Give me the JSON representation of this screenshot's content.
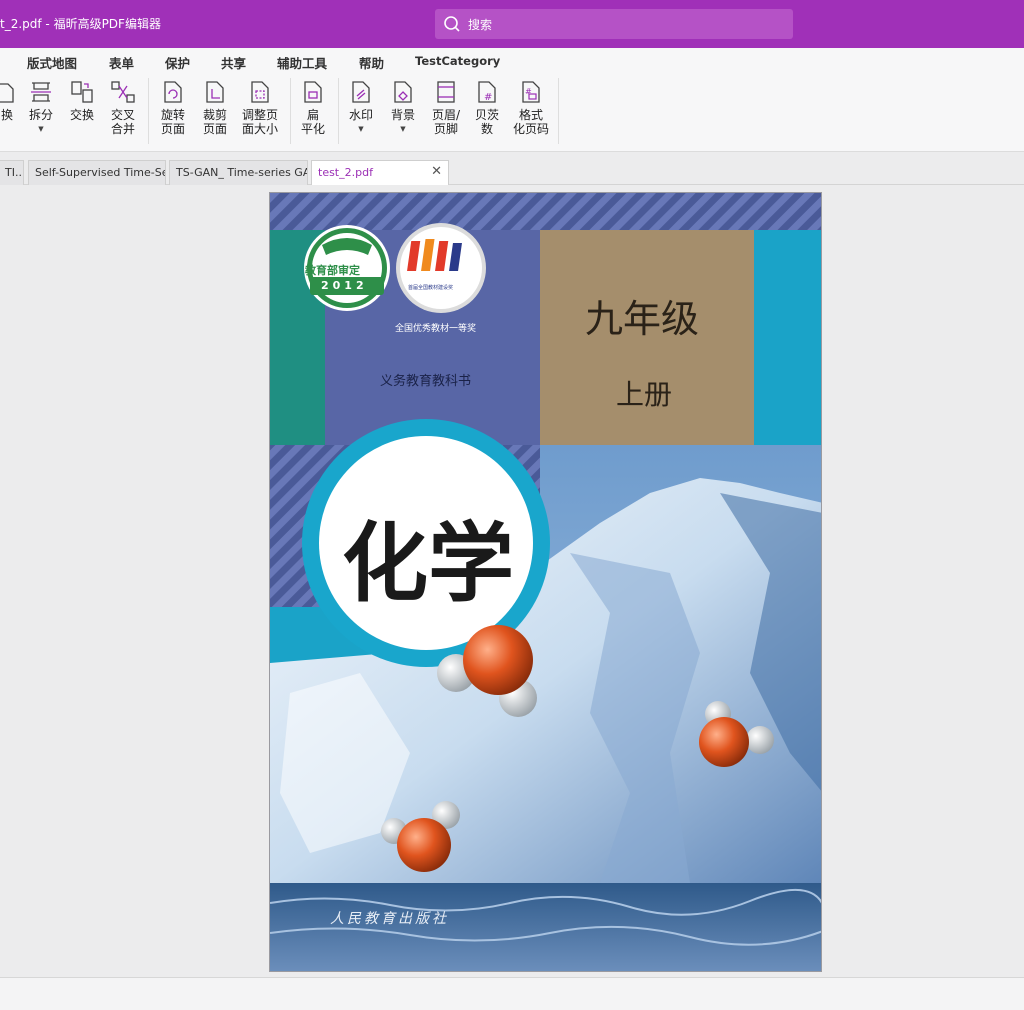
{
  "window": {
    "title": "t_2.pdf - 福昕高级PDF编辑器"
  },
  "search": {
    "placeholder": "搜索"
  },
  "menu": [
    "版式地图",
    "表单",
    "保护",
    "共享",
    "辅助工具",
    "帮助",
    "TestCategory"
  ],
  "toolbar": {
    "items": [
      {
        "label": "换",
        "icon": "page-swap-icon"
      },
      {
        "label": "拆分",
        "icon": "split-icon",
        "dropdown": true
      },
      {
        "label": "交换",
        "icon": "swap-pages-icon"
      },
      {
        "label": "交叉\n合并",
        "icon": "cross-merge-icon"
      },
      {
        "label": "旋转\n页面",
        "icon": "rotate-page-icon",
        "dropdown": true
      },
      {
        "label": "裁剪\n页面",
        "icon": "crop-page-icon"
      },
      {
        "label": "调整页\n面大小",
        "icon": "resize-page-icon"
      },
      {
        "label": "扁\n平化",
        "icon": "flatten-icon"
      },
      {
        "label": "水印",
        "icon": "watermark-icon",
        "dropdown": true
      },
      {
        "label": "背景",
        "icon": "background-icon",
        "dropdown": true
      },
      {
        "label": "页眉/\n页脚",
        "icon": "header-footer-icon",
        "dropdown": true
      },
      {
        "label": "贝茨\n数",
        "icon": "bates-number-icon",
        "dropdown": true
      },
      {
        "label": "格式\n化页码",
        "icon": "format-page-number-icon"
      }
    ]
  },
  "tabs": [
    {
      "label": "TI..."
    },
    {
      "label": "Self-Supervised Time-Se..."
    },
    {
      "label": "TS-GAN_ Time-series GA..."
    },
    {
      "label": "test_2.pdf",
      "active": true
    }
  ],
  "cover": {
    "badge_text": "教育部审定",
    "badge_year": "2012",
    "award_ring_text": "首届全国教材建设奖",
    "award_caption": "全国优秀教材一等奖",
    "series": "义务教育教科书",
    "grade": "九年级",
    "volume": "上册",
    "subject": "化学",
    "publisher": "人民教育出版社"
  },
  "colors": {
    "accent": "#a030b8",
    "search_bg": "#b552c6",
    "active_tab_text": "#9b2fb5"
  }
}
